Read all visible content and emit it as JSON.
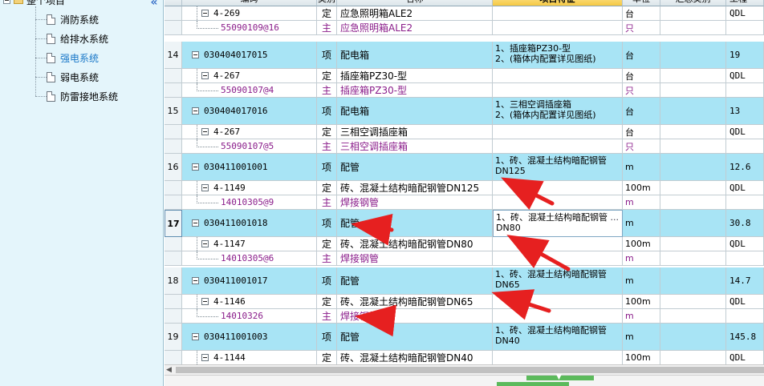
{
  "tree": {
    "root_label": "整个项目",
    "items": [
      {
        "label": "消防系统",
        "active": false
      },
      {
        "label": "给排水系统",
        "active": false
      },
      {
        "label": "强电系统",
        "active": true
      },
      {
        "label": "弱电系统",
        "active": false
      },
      {
        "label": "防雷接地系统",
        "active": false
      }
    ]
  },
  "grid": {
    "headers": {
      "code": "编码",
      "type": "类别",
      "name": "名称",
      "feature": "项目特征",
      "unit": "单位",
      "summary": "汇总类别",
      "qty_expr": "工程量..."
    },
    "rows": [
      {
        "kind": "de",
        "idx": "",
        "code": "4-269",
        "type": "定",
        "name": "应急照明箱ALE2",
        "feature": "",
        "unit": "台",
        "qty": "QDL"
      },
      {
        "kind": "zc",
        "idx": "",
        "code": "55090109@16",
        "type": "主",
        "name": "应急照明箱ALE2",
        "feature": "",
        "unit": "只",
        "qty": ""
      },
      {
        "kind": "qd",
        "idx": "14",
        "code": "030404017015",
        "type": "项",
        "name": "配电箱",
        "feature": "1、插座箱PZ30-型\n2、(箱体内配置详见图纸)",
        "unit": "台",
        "qty": "19"
      },
      {
        "kind": "de",
        "idx": "",
        "code": "4-267",
        "type": "定",
        "name": "插座箱PZ30-型",
        "feature": "",
        "unit": "台",
        "qty": "QDL"
      },
      {
        "kind": "zc",
        "idx": "",
        "code": "55090107@4",
        "type": "主",
        "name": "插座箱PZ30-型",
        "feature": "",
        "unit": "只",
        "qty": ""
      },
      {
        "kind": "qd",
        "idx": "15",
        "code": "030404017016",
        "type": "项",
        "name": "配电箱",
        "feature": "1、三相空调插座箱\n2、(箱体内配置详见图纸)",
        "unit": "台",
        "qty": "13"
      },
      {
        "kind": "de",
        "idx": "",
        "code": "4-267",
        "type": "定",
        "name": "三相空调插座箱",
        "feature": "",
        "unit": "台",
        "qty": "QDL"
      },
      {
        "kind": "zc",
        "idx": "",
        "code": "55090107@5",
        "type": "主",
        "name": "三相空调插座箱",
        "feature": "",
        "unit": "只",
        "qty": ""
      },
      {
        "kind": "qd",
        "idx": "16",
        "code": "030411001001",
        "type": "项",
        "name": "配管",
        "feature": "1、砖、混凝土结构暗配钢管DN125",
        "unit": "m",
        "qty": "12.6"
      },
      {
        "kind": "de",
        "idx": "",
        "code": "4-1149",
        "type": "定",
        "name": "砖、混凝土结构暗配钢管DN125",
        "feature": "",
        "unit": "100m",
        "qty": "QDL"
      },
      {
        "kind": "zc",
        "idx": "",
        "code": "14010305@9",
        "type": "主",
        "name": "焊接钢管",
        "feature": "",
        "unit": "m",
        "qty": ""
      },
      {
        "kind": "qd",
        "idx": "17",
        "code": "030411001018",
        "type": "项",
        "name": "配管",
        "feature": "1、砖、混凝土结构暗配钢管DN80",
        "unit": "m",
        "qty": "30.8",
        "selected": true
      },
      {
        "kind": "de",
        "idx": "",
        "code": "4-1147",
        "type": "定",
        "name": "砖、混凝土结构暗配钢管DN80",
        "feature": "",
        "unit": "100m",
        "qty": "QDL"
      },
      {
        "kind": "zc",
        "idx": "",
        "code": "14010305@6",
        "type": "主",
        "name": "焊接钢管",
        "feature": "",
        "unit": "m",
        "qty": ""
      },
      {
        "kind": "qd",
        "idx": "18",
        "code": "030411001017",
        "type": "项",
        "name": "配管",
        "feature": "1、砖、混凝土结构暗配钢管DN65",
        "unit": "m",
        "qty": "14.7"
      },
      {
        "kind": "de",
        "idx": "",
        "code": "4-1146",
        "type": "定",
        "name": "砖、混凝土结构暗配钢管DN65",
        "feature": "",
        "unit": "100m",
        "qty": "QDL"
      },
      {
        "kind": "zc",
        "idx": "",
        "code": "14010326",
        "type": "主",
        "name": "焊接钢管",
        "feature": "",
        "unit": "m",
        "qty": ""
      },
      {
        "kind": "qd",
        "idx": "19",
        "code": "030411001003",
        "type": "项",
        "name": "配管",
        "feature": "1、砖、混凝土结构暗配钢管DN40",
        "unit": "m",
        "qty": "145.8"
      },
      {
        "kind": "de",
        "idx": "",
        "code": "4-1144",
        "type": "定",
        "name": "砖、混凝土结构暗配钢管DN40",
        "feature": "",
        "unit": "100m",
        "qty": "QDL"
      }
    ],
    "edit_button_label": "..."
  },
  "colors": {
    "list_row_bg": "#a8e4f5",
    "main_material_text": "#8a1c8a",
    "annotation_arrow": "#e62020"
  }
}
